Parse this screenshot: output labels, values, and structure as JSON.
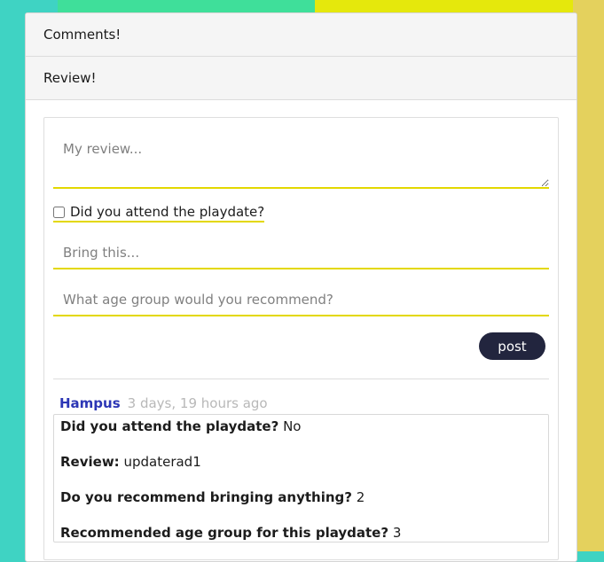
{
  "accordion": {
    "comments_title": "Comments!",
    "review_title": "Review!"
  },
  "form": {
    "review_placeholder": "My review...",
    "attend_label": "Did you attend the playdate?",
    "bring_placeholder": "Bring this...",
    "age_placeholder": "What age group would you recommend?",
    "post_label": "post"
  },
  "comment": {
    "author": "Hampus",
    "time": "3 days, 19 hours ago",
    "lines": [
      {
        "label": "Did you attend the playdate?",
        "value": "No"
      },
      {
        "label": "Review:",
        "value": "updaterad1"
      },
      {
        "label": "Do you recommend bringing anything?",
        "value": "2"
      },
      {
        "label": "Recommended age group for this playdate?",
        "value": "3"
      }
    ]
  },
  "colors": {
    "accent_underline": "#e3d800",
    "author": "#2c36b5",
    "post_button": "#22253e"
  }
}
